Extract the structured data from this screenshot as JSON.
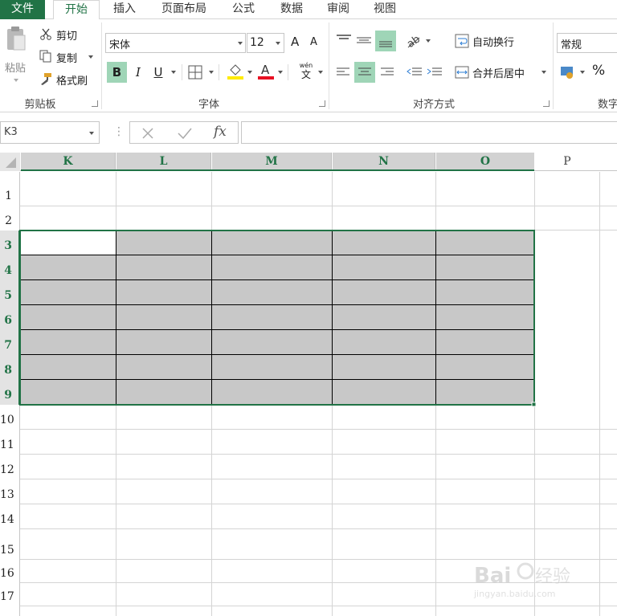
{
  "ribbon_tabs": [
    "文件",
    "开始",
    "插入",
    "页面布局",
    "公式",
    "数据",
    "审阅",
    "视图"
  ],
  "clipboard": {
    "paste": "粘贴",
    "cut": "剪切",
    "copy": "复制",
    "format_painter": "格式刷",
    "group": "剪贴板"
  },
  "font": {
    "name": "宋体",
    "size": "12",
    "group": "字体",
    "bold": "B",
    "italic": "I",
    "underline": "U",
    "phonetic_top": "wén",
    "phonetic_bottom": "文",
    "grow": "A",
    "shrink": "A"
  },
  "alignment": {
    "wrap": "自动换行",
    "merge": "合并后居中",
    "group": "对齐方式"
  },
  "number": {
    "format": "常规",
    "percent": "%",
    "group": "数字"
  },
  "formula_bar": {
    "name_box": "K3",
    "fx": "fx",
    "value": ""
  },
  "columns": [
    "K",
    "L",
    "M",
    "N",
    "O",
    "P"
  ],
  "rows": [
    "1",
    "2",
    "3",
    "4",
    "5",
    "6",
    "7",
    "8",
    "9",
    "10",
    "11",
    "12",
    "13",
    "14",
    "15",
    "16",
    "17"
  ],
  "colors": {
    "accent": "#217346",
    "selection_fill": "#c8c8c8",
    "highlight_bar": "#ffeb00",
    "font_color_bar": "#e81123"
  },
  "watermark": "Baidu经验 jingyan.baidu.com"
}
